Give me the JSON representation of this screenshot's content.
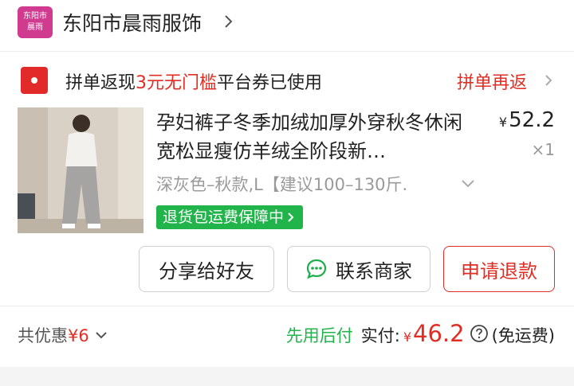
{
  "shop": {
    "logo_line1": "东阳市",
    "logo_line2": "晨雨",
    "name": "东阳市晨雨服饰"
  },
  "coupon": {
    "prefix": "拼单返现",
    "highlight": "3元无门槛",
    "suffix": "平台券已使用",
    "action": "拼单再返"
  },
  "product": {
    "title": "孕妇裤子冬季加绒加厚外穿秋冬休闲宽松显瘦仿羊绒全阶段新…",
    "price_symbol": "¥",
    "price": "52.2",
    "quantity": "×1",
    "spec": "深灰色–秋款,L【建议100–130斤.",
    "return_badge": "退货包运费保障中"
  },
  "actions": {
    "share": "分享给好友",
    "contact": "联系商家",
    "refund": "申请退款"
  },
  "summary": {
    "discount_label": "共优惠",
    "discount_amount": "¥6",
    "pay_later": "先用后付",
    "paid_label": "实付:",
    "paid_symbol": "¥",
    "paid_amount": "46.2",
    "shipping": "(免运费)"
  },
  "colors": {
    "accent_red": "#e02e24",
    "green": "#20b44b",
    "logo_pink": "#d03a8f"
  }
}
